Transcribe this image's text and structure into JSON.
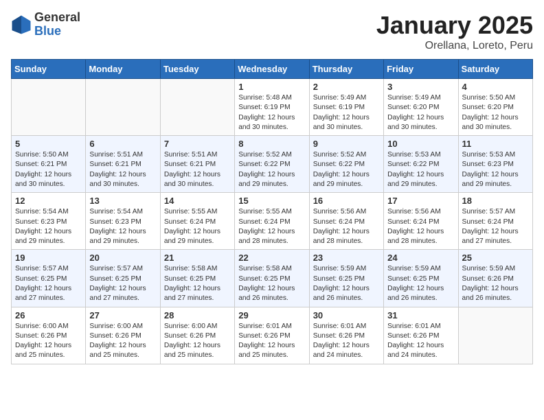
{
  "logo": {
    "general": "General",
    "blue": "Blue"
  },
  "title": "January 2025",
  "location": "Orellana, Loreto, Peru",
  "days_of_week": [
    "Sunday",
    "Monday",
    "Tuesday",
    "Wednesday",
    "Thursday",
    "Friday",
    "Saturday"
  ],
  "weeks": [
    [
      {
        "day": "",
        "info": ""
      },
      {
        "day": "",
        "info": ""
      },
      {
        "day": "",
        "info": ""
      },
      {
        "day": "1",
        "info": "Sunrise: 5:48 AM\nSunset: 6:19 PM\nDaylight: 12 hours and 30 minutes."
      },
      {
        "day": "2",
        "info": "Sunrise: 5:49 AM\nSunset: 6:19 PM\nDaylight: 12 hours and 30 minutes."
      },
      {
        "day": "3",
        "info": "Sunrise: 5:49 AM\nSunset: 6:20 PM\nDaylight: 12 hours and 30 minutes."
      },
      {
        "day": "4",
        "info": "Sunrise: 5:50 AM\nSunset: 6:20 PM\nDaylight: 12 hours and 30 minutes."
      }
    ],
    [
      {
        "day": "5",
        "info": "Sunrise: 5:50 AM\nSunset: 6:21 PM\nDaylight: 12 hours and 30 minutes."
      },
      {
        "day": "6",
        "info": "Sunrise: 5:51 AM\nSunset: 6:21 PM\nDaylight: 12 hours and 30 minutes."
      },
      {
        "day": "7",
        "info": "Sunrise: 5:51 AM\nSunset: 6:21 PM\nDaylight: 12 hours and 30 minutes."
      },
      {
        "day": "8",
        "info": "Sunrise: 5:52 AM\nSunset: 6:22 PM\nDaylight: 12 hours and 29 minutes."
      },
      {
        "day": "9",
        "info": "Sunrise: 5:52 AM\nSunset: 6:22 PM\nDaylight: 12 hours and 29 minutes."
      },
      {
        "day": "10",
        "info": "Sunrise: 5:53 AM\nSunset: 6:22 PM\nDaylight: 12 hours and 29 minutes."
      },
      {
        "day": "11",
        "info": "Sunrise: 5:53 AM\nSunset: 6:23 PM\nDaylight: 12 hours and 29 minutes."
      }
    ],
    [
      {
        "day": "12",
        "info": "Sunrise: 5:54 AM\nSunset: 6:23 PM\nDaylight: 12 hours and 29 minutes."
      },
      {
        "day": "13",
        "info": "Sunrise: 5:54 AM\nSunset: 6:23 PM\nDaylight: 12 hours and 29 minutes."
      },
      {
        "day": "14",
        "info": "Sunrise: 5:55 AM\nSunset: 6:24 PM\nDaylight: 12 hours and 29 minutes."
      },
      {
        "day": "15",
        "info": "Sunrise: 5:55 AM\nSunset: 6:24 PM\nDaylight: 12 hours and 28 minutes."
      },
      {
        "day": "16",
        "info": "Sunrise: 5:56 AM\nSunset: 6:24 PM\nDaylight: 12 hours and 28 minutes."
      },
      {
        "day": "17",
        "info": "Sunrise: 5:56 AM\nSunset: 6:24 PM\nDaylight: 12 hours and 28 minutes."
      },
      {
        "day": "18",
        "info": "Sunrise: 5:57 AM\nSunset: 6:24 PM\nDaylight: 12 hours and 27 minutes."
      }
    ],
    [
      {
        "day": "19",
        "info": "Sunrise: 5:57 AM\nSunset: 6:25 PM\nDaylight: 12 hours and 27 minutes."
      },
      {
        "day": "20",
        "info": "Sunrise: 5:57 AM\nSunset: 6:25 PM\nDaylight: 12 hours and 27 minutes."
      },
      {
        "day": "21",
        "info": "Sunrise: 5:58 AM\nSunset: 6:25 PM\nDaylight: 12 hours and 27 minutes."
      },
      {
        "day": "22",
        "info": "Sunrise: 5:58 AM\nSunset: 6:25 PM\nDaylight: 12 hours and 26 minutes."
      },
      {
        "day": "23",
        "info": "Sunrise: 5:59 AM\nSunset: 6:25 PM\nDaylight: 12 hours and 26 minutes."
      },
      {
        "day": "24",
        "info": "Sunrise: 5:59 AM\nSunset: 6:25 PM\nDaylight: 12 hours and 26 minutes."
      },
      {
        "day": "25",
        "info": "Sunrise: 5:59 AM\nSunset: 6:26 PM\nDaylight: 12 hours and 26 minutes."
      }
    ],
    [
      {
        "day": "26",
        "info": "Sunrise: 6:00 AM\nSunset: 6:26 PM\nDaylight: 12 hours and 25 minutes."
      },
      {
        "day": "27",
        "info": "Sunrise: 6:00 AM\nSunset: 6:26 PM\nDaylight: 12 hours and 25 minutes."
      },
      {
        "day": "28",
        "info": "Sunrise: 6:00 AM\nSunset: 6:26 PM\nDaylight: 12 hours and 25 minutes."
      },
      {
        "day": "29",
        "info": "Sunrise: 6:01 AM\nSunset: 6:26 PM\nDaylight: 12 hours and 25 minutes."
      },
      {
        "day": "30",
        "info": "Sunrise: 6:01 AM\nSunset: 6:26 PM\nDaylight: 12 hours and 24 minutes."
      },
      {
        "day": "31",
        "info": "Sunrise: 6:01 AM\nSunset: 6:26 PM\nDaylight: 12 hours and 24 minutes."
      },
      {
        "day": "",
        "info": ""
      }
    ]
  ]
}
